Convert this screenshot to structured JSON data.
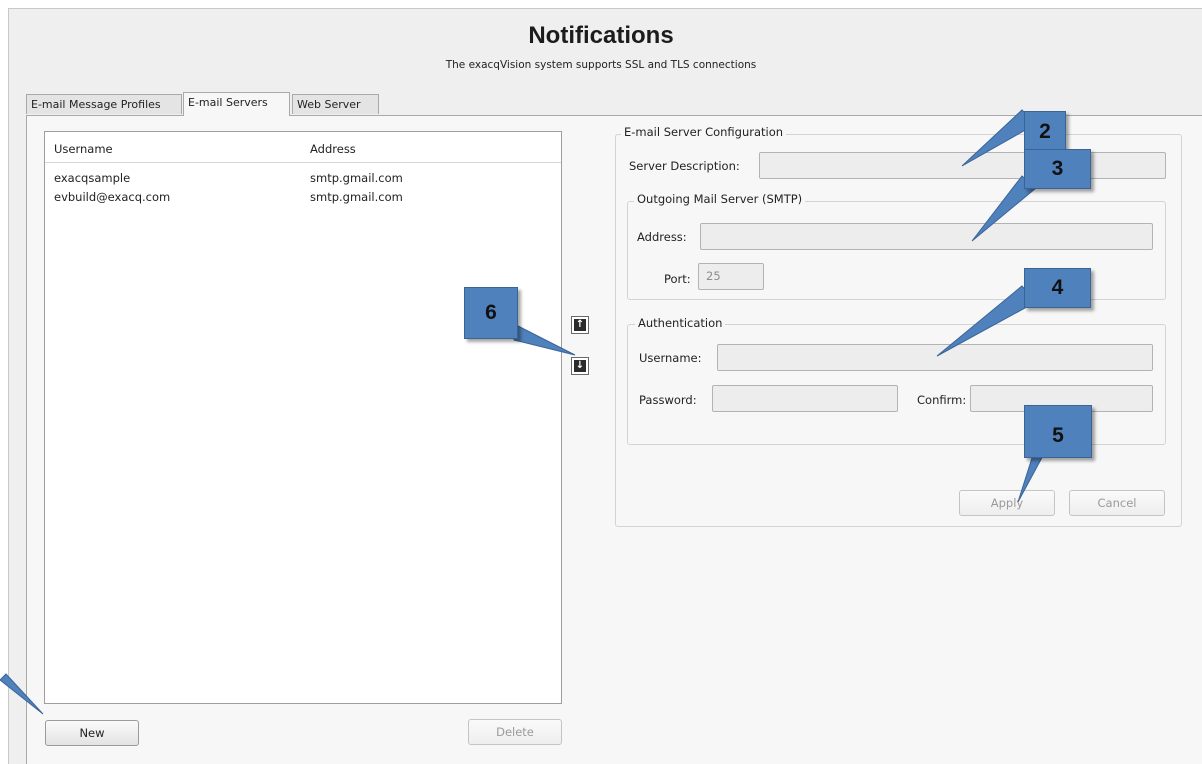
{
  "header": {
    "title": "Notifications",
    "subtitle": "The exacqVision system supports SSL and TLS connections"
  },
  "tabs": [
    {
      "label": "E-mail Message Profiles"
    },
    {
      "label": "E-mail Servers",
      "active": true
    },
    {
      "label": "Web Server"
    }
  ],
  "server_list": {
    "columns": [
      "Username",
      "Address"
    ],
    "rows": [
      {
        "username": "exacqsample",
        "address": "smtp.gmail.com"
      },
      {
        "username": "evbuild@exacq.com",
        "address": "smtp.gmail.com"
      }
    ],
    "new_label": "New",
    "delete_label": "Delete"
  },
  "reorder": {
    "up_icon": "arrow-up-icon",
    "down_icon": "arrow-down-icon"
  },
  "config": {
    "group_title": "E-mail Server Configuration",
    "server_description_label": "Server Description:",
    "server_description_value": "",
    "smtp": {
      "group_title": "Outgoing Mail Server (SMTP)",
      "address_label": "Address:",
      "address_value": "",
      "port_label": "Port:",
      "port_value": "25"
    },
    "auth": {
      "group_title": "Authentication",
      "username_label": "Username:",
      "username_value": "",
      "password_label": "Password:",
      "confirm_label": "Confirm:"
    },
    "apply_label": "Apply",
    "cancel_label": "Cancel"
  },
  "callouts": [
    "2",
    "3",
    "4",
    "5",
    "6"
  ],
  "colors": {
    "callout": "#4f81bd",
    "callout_border": "#3a6496"
  }
}
